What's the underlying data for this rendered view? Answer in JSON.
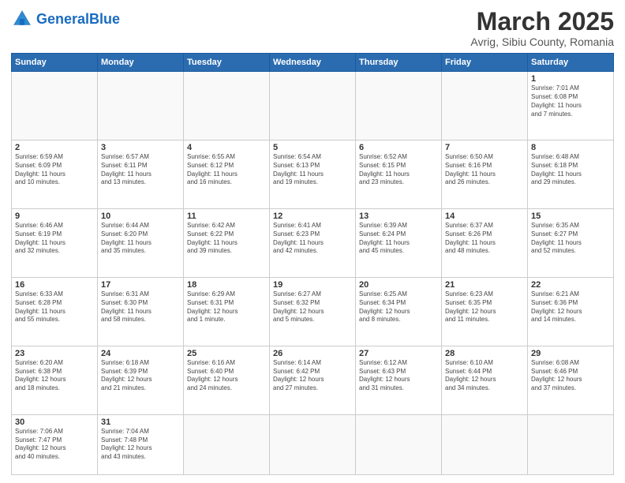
{
  "header": {
    "logo_general": "General",
    "logo_blue": "Blue",
    "month_title": "March 2025",
    "location": "Avrig, Sibiu County, Romania"
  },
  "weekdays": [
    "Sunday",
    "Monday",
    "Tuesday",
    "Wednesday",
    "Thursday",
    "Friday",
    "Saturday"
  ],
  "weeks": [
    [
      {
        "day": "",
        "info": ""
      },
      {
        "day": "",
        "info": ""
      },
      {
        "day": "",
        "info": ""
      },
      {
        "day": "",
        "info": ""
      },
      {
        "day": "",
        "info": ""
      },
      {
        "day": "",
        "info": ""
      },
      {
        "day": "1",
        "info": "Sunrise: 7:01 AM\nSunset: 6:08 PM\nDaylight: 11 hours\nand 7 minutes."
      }
    ],
    [
      {
        "day": "2",
        "info": "Sunrise: 6:59 AM\nSunset: 6:09 PM\nDaylight: 11 hours\nand 10 minutes."
      },
      {
        "day": "3",
        "info": "Sunrise: 6:57 AM\nSunset: 6:11 PM\nDaylight: 11 hours\nand 13 minutes."
      },
      {
        "day": "4",
        "info": "Sunrise: 6:55 AM\nSunset: 6:12 PM\nDaylight: 11 hours\nand 16 minutes."
      },
      {
        "day": "5",
        "info": "Sunrise: 6:54 AM\nSunset: 6:13 PM\nDaylight: 11 hours\nand 19 minutes."
      },
      {
        "day": "6",
        "info": "Sunrise: 6:52 AM\nSunset: 6:15 PM\nDaylight: 11 hours\nand 23 minutes."
      },
      {
        "day": "7",
        "info": "Sunrise: 6:50 AM\nSunset: 6:16 PM\nDaylight: 11 hours\nand 26 minutes."
      },
      {
        "day": "8",
        "info": "Sunrise: 6:48 AM\nSunset: 6:18 PM\nDaylight: 11 hours\nand 29 minutes."
      }
    ],
    [
      {
        "day": "9",
        "info": "Sunrise: 6:46 AM\nSunset: 6:19 PM\nDaylight: 11 hours\nand 32 minutes."
      },
      {
        "day": "10",
        "info": "Sunrise: 6:44 AM\nSunset: 6:20 PM\nDaylight: 11 hours\nand 35 minutes."
      },
      {
        "day": "11",
        "info": "Sunrise: 6:42 AM\nSunset: 6:22 PM\nDaylight: 11 hours\nand 39 minutes."
      },
      {
        "day": "12",
        "info": "Sunrise: 6:41 AM\nSunset: 6:23 PM\nDaylight: 11 hours\nand 42 minutes."
      },
      {
        "day": "13",
        "info": "Sunrise: 6:39 AM\nSunset: 6:24 PM\nDaylight: 11 hours\nand 45 minutes."
      },
      {
        "day": "14",
        "info": "Sunrise: 6:37 AM\nSunset: 6:26 PM\nDaylight: 11 hours\nand 48 minutes."
      },
      {
        "day": "15",
        "info": "Sunrise: 6:35 AM\nSunset: 6:27 PM\nDaylight: 11 hours\nand 52 minutes."
      }
    ],
    [
      {
        "day": "16",
        "info": "Sunrise: 6:33 AM\nSunset: 6:28 PM\nDaylight: 11 hours\nand 55 minutes."
      },
      {
        "day": "17",
        "info": "Sunrise: 6:31 AM\nSunset: 6:30 PM\nDaylight: 11 hours\nand 58 minutes."
      },
      {
        "day": "18",
        "info": "Sunrise: 6:29 AM\nSunset: 6:31 PM\nDaylight: 12 hours\nand 1 minute."
      },
      {
        "day": "19",
        "info": "Sunrise: 6:27 AM\nSunset: 6:32 PM\nDaylight: 12 hours\nand 5 minutes."
      },
      {
        "day": "20",
        "info": "Sunrise: 6:25 AM\nSunset: 6:34 PM\nDaylight: 12 hours\nand 8 minutes."
      },
      {
        "day": "21",
        "info": "Sunrise: 6:23 AM\nSunset: 6:35 PM\nDaylight: 12 hours\nand 11 minutes."
      },
      {
        "day": "22",
        "info": "Sunrise: 6:21 AM\nSunset: 6:36 PM\nDaylight: 12 hours\nand 14 minutes."
      }
    ],
    [
      {
        "day": "23",
        "info": "Sunrise: 6:20 AM\nSunset: 6:38 PM\nDaylight: 12 hours\nand 18 minutes."
      },
      {
        "day": "24",
        "info": "Sunrise: 6:18 AM\nSunset: 6:39 PM\nDaylight: 12 hours\nand 21 minutes."
      },
      {
        "day": "25",
        "info": "Sunrise: 6:16 AM\nSunset: 6:40 PM\nDaylight: 12 hours\nand 24 minutes."
      },
      {
        "day": "26",
        "info": "Sunrise: 6:14 AM\nSunset: 6:42 PM\nDaylight: 12 hours\nand 27 minutes."
      },
      {
        "day": "27",
        "info": "Sunrise: 6:12 AM\nSunset: 6:43 PM\nDaylight: 12 hours\nand 31 minutes."
      },
      {
        "day": "28",
        "info": "Sunrise: 6:10 AM\nSunset: 6:44 PM\nDaylight: 12 hours\nand 34 minutes."
      },
      {
        "day": "29",
        "info": "Sunrise: 6:08 AM\nSunset: 6:46 PM\nDaylight: 12 hours\nand 37 minutes."
      }
    ],
    [
      {
        "day": "30",
        "info": "Sunrise: 7:06 AM\nSunset: 7:47 PM\nDaylight: 12 hours\nand 40 minutes."
      },
      {
        "day": "31",
        "info": "Sunrise: 7:04 AM\nSunset: 7:48 PM\nDaylight: 12 hours\nand 43 minutes."
      },
      {
        "day": "",
        "info": ""
      },
      {
        "day": "",
        "info": ""
      },
      {
        "day": "",
        "info": ""
      },
      {
        "day": "",
        "info": ""
      },
      {
        "day": "",
        "info": ""
      }
    ]
  ]
}
